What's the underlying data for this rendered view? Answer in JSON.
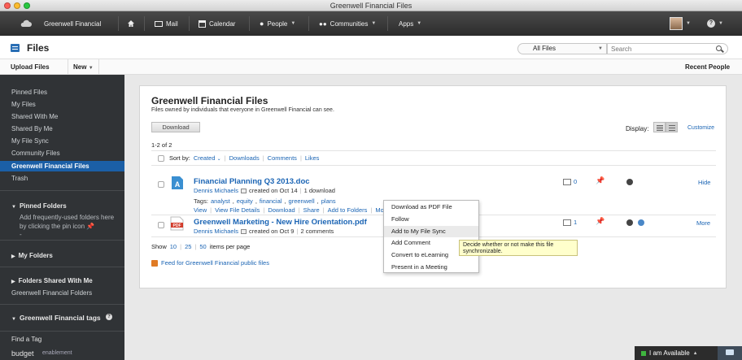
{
  "window": {
    "title": "Greenwell Financial Files"
  },
  "topnav": {
    "brand": "Greenwell Financial",
    "mail": "Mail",
    "calendar": "Calendar",
    "people": "People",
    "communities": "Communities",
    "apps": "Apps"
  },
  "files_header": {
    "title": "Files",
    "scope": "All Files",
    "search_placeholder": "Search"
  },
  "toolbar": {
    "upload": "Upload Files",
    "new": "New",
    "recent_people": "Recent People"
  },
  "sidebar": {
    "items": [
      "Pinned Files",
      "My Files",
      "Shared With Me",
      "Shared By Me",
      "My File Sync",
      "Community Files",
      "Greenwell Financial Files",
      "Trash"
    ],
    "pinned_folders": "Pinned Folders",
    "pinned_note": "Add frequently-used folders here by clicking the pin icon",
    "pinned_dash": "-",
    "my_folders": "My Folders",
    "folders_shared": "Folders Shared With Me",
    "gf_folders": "Greenwell Financial Folders",
    "tags_heading": "Greenwell Financial tags",
    "find_tag": "Find a Tag",
    "tag1": "budget",
    "tag2": "enablement"
  },
  "panel": {
    "title": "Greenwell Financial Files",
    "subtitle": "Files owned by individuals that everyone in Greenwell Financial can see.",
    "download_btn": "Download",
    "display_label": "Display:",
    "customize": "Customize",
    "count": "1-2 of 2",
    "sort_by": "Sort by:",
    "sort_created": "Created",
    "sort_downloads": "Downloads",
    "sort_comments": "Comments",
    "sort_likes": "Likes",
    "show_label": "Show",
    "show_10": "10",
    "show_25": "25",
    "show_50": "50",
    "show_suffix": "items per page",
    "feed": "Feed for Greenwell Financial public files"
  },
  "files": [
    {
      "name": "Financial Planning Q3 2013.doc",
      "owner": "Dennis Michaels",
      "created": "created on Oct 14",
      "stat": "1 download",
      "tags_label": "Tags:",
      "tags": [
        "analyst",
        "equity",
        "financial",
        "greenwell",
        "plans"
      ],
      "comments": "0",
      "action": "Hide",
      "actions": [
        "View",
        "View File Details",
        "Download",
        "Share",
        "Add to Folders",
        "More Actions"
      ]
    },
    {
      "name": "Greenwell Marketing - New Hire Orientation.pdf",
      "owner": "Dennis Michaels",
      "created": "created on Oct 9",
      "stat": "2 comments",
      "comments": "1",
      "action": "More"
    }
  ],
  "menu": {
    "items": [
      "Download as PDF File",
      "Follow",
      "Add to My File Sync",
      "Add Comment",
      "Convert to eLearning",
      "Present in a Meeting"
    ],
    "highlighted": 2
  },
  "tooltip": {
    "text": "Decide whether or not make this file synchronizable."
  },
  "statusbar": {
    "label": "I am Available"
  },
  "colors": {
    "accent": "#1b5fa6",
    "link": "#1a64b4",
    "sidebar": "#303336",
    "topnav": "#2c2c2c"
  },
  "icons": [
    "cloud-logo-icon",
    "home-icon",
    "mail-icon",
    "calendar-icon",
    "person-icon",
    "communities-icon",
    "help-icon",
    "files-icon",
    "search-icon",
    "doc-file-icon",
    "pdf-file-icon",
    "pin-icon",
    "sync-icon",
    "comment-icon",
    "feed-icon",
    "chat-icon"
  ]
}
